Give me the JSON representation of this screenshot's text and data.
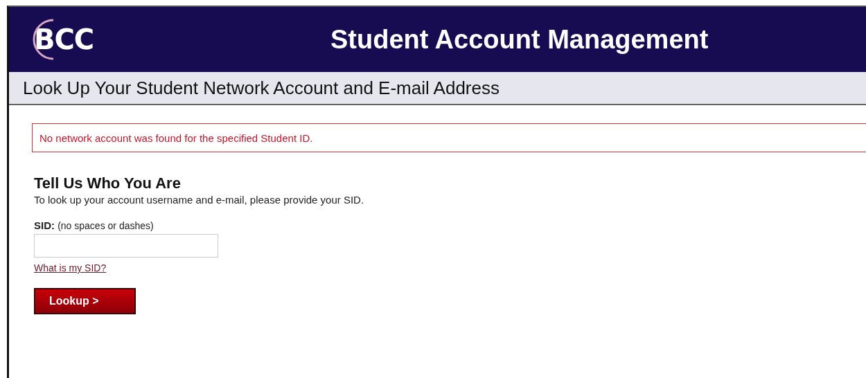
{
  "header": {
    "logo": "BCC",
    "title": "Student Account Management"
  },
  "subheader": {
    "title": "Look Up Your Student Network Account and E-mail Address"
  },
  "error": {
    "message": "No network account was found for the specified Student ID."
  },
  "form": {
    "heading": "Tell Us Who You Are",
    "intro": "To look up your account username and e-mail, please provide your SID.",
    "field_label": "SID:",
    "field_hint": "(no spaces or dashes)",
    "help_link": "What is my SID?",
    "button": "Lookup >"
  }
}
